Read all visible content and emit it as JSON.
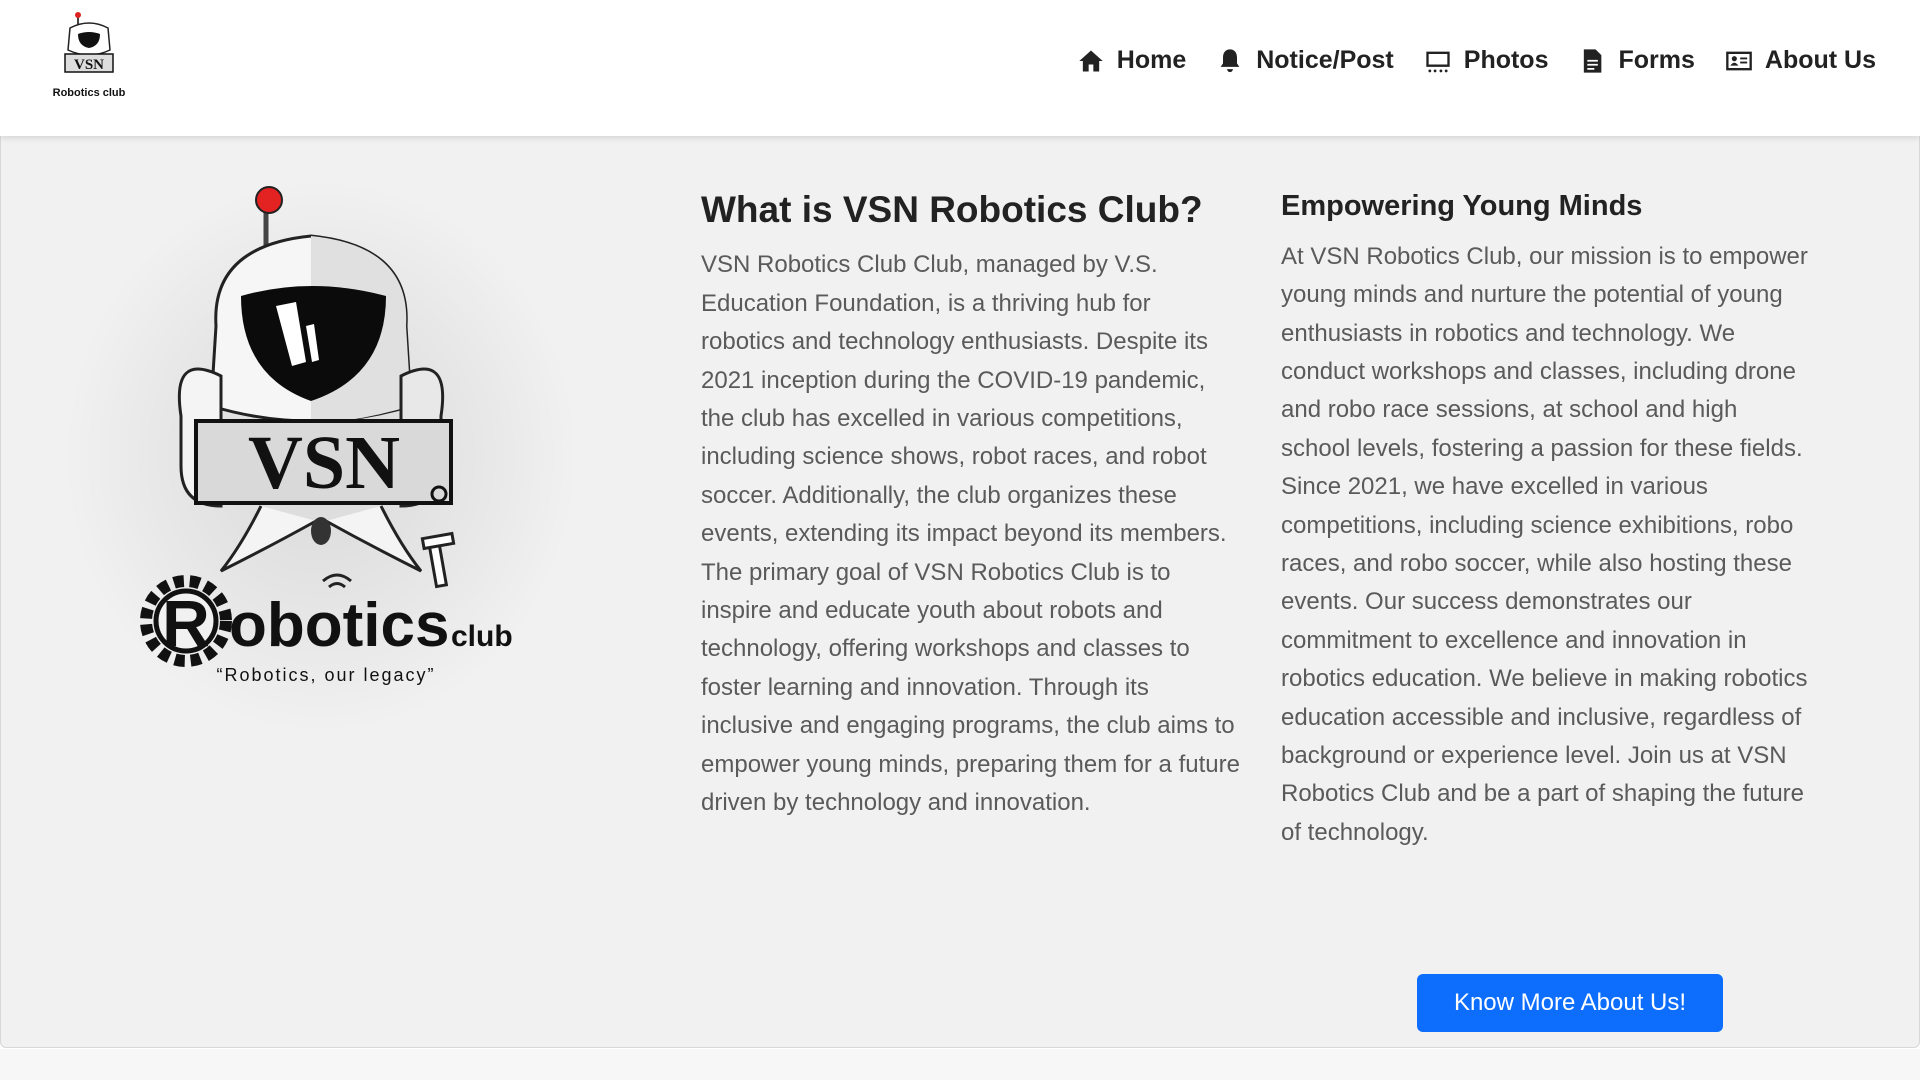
{
  "nav": {
    "logo_text": "VSN",
    "logo_subtext": "Robotics club",
    "items": [
      {
        "label": "Home",
        "icon": "home-icon"
      },
      {
        "label": "Notice/Post",
        "icon": "bell-icon"
      },
      {
        "label": "Photos",
        "icon": "photos-icon"
      },
      {
        "label": "Forms",
        "icon": "file-icon"
      },
      {
        "label": "About Us",
        "icon": "id-card-icon"
      }
    ]
  },
  "hero_logo": {
    "main": "VSN",
    "sub": "Robotics",
    "club": "club",
    "tagline": "“Robotics, our legacy”"
  },
  "about": {
    "title": "What is VSN Robotics Club?",
    "text": "VSN Robotics Club Club, managed by V.S. Education Foundation, is a thriving hub for robotics and technology enthusiasts. Despite its 2021 inception during the COVID-19 pandemic, the club has excelled in various competitions, including science shows, robot races, and robot soccer. Additionally, the club organizes these events, extending its impact beyond its members. The primary goal of VSN Robotics Club is to inspire and educate youth about robots and technology, offering workshops and classes to foster learning and innovation. Through its inclusive and engaging programs, the club aims to empower young minds, preparing them for a future driven by technology and innovation."
  },
  "mission": {
    "title": "Empowering Young Minds",
    "text": "At VSN Robotics Club, our mission is to empower young minds and nurture the potential of young enthusiasts in robotics and technology. We conduct workshops and classes, including drone and robo race sessions, at school and high school levels, fostering a passion for these fields. Since 2021, we have excelled in various competitions, including science exhibitions, robo races, and robo soccer, while also hosting these events. Our success demonstrates our commitment to excellence and innovation in robotics education. We believe in making robotics education accessible and inclusive, regardless of background or experience level. Join us at VSN Robotics Club and be a part of shaping the future of technology."
  },
  "cta": {
    "label": "Know More About Us!"
  },
  "colors": {
    "accent": "#0d6efd",
    "section_bg": "#f1f1f1",
    "text_muted": "#5a5a5a"
  }
}
